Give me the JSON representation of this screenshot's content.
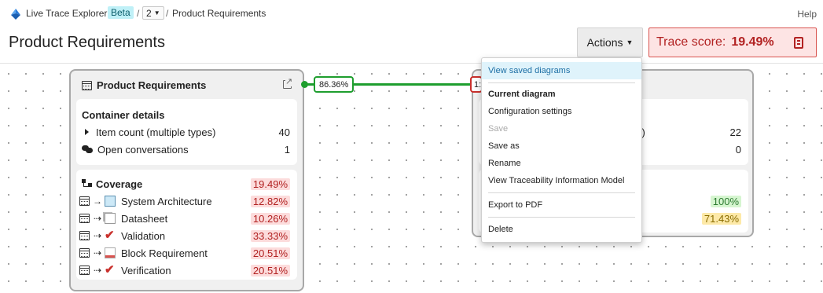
{
  "header": {
    "app_title": "Live Trace Explorer",
    "beta_badge": "Beta",
    "separator": "/",
    "version_value": "2",
    "breadcrumb_current": "Product Requirements",
    "help_label": "Help"
  },
  "page": {
    "title": "Product Requirements",
    "actions_label": "Actions",
    "trace_score_label": "Trace score:",
    "trace_score_value": "19.49%"
  },
  "left_card": {
    "title": "Product Requirements",
    "details_title": "Container details",
    "item_count_label": "Item count (multiple types)",
    "item_count_value": "40",
    "conversations_label": "Open conversations",
    "conversations_value": "1",
    "coverage_title": "Coverage",
    "coverage_total": "19.49%",
    "coverage_rows": [
      {
        "label": "System Architecture",
        "value": "12.82%"
      },
      {
        "label": "Datasheet",
        "value": "10.26%"
      },
      {
        "label": "Validation",
        "value": "33.33%"
      },
      {
        "label": "Block Requirement",
        "value": "20.51%"
      },
      {
        "label": "Verification",
        "value": "20.51%"
      }
    ]
  },
  "link": {
    "left_pct": "86.36%",
    "right_pct_partial": "1:"
  },
  "right_card": {
    "row1_label_partial": "ypes)",
    "row1_value": "22",
    "row2_value": "0",
    "cov1": "100%",
    "cov2": "71.43%"
  },
  "actions_menu": {
    "items": [
      "View saved diagrams",
      "Current diagram",
      "Configuration settings",
      "Save",
      "Save as",
      "Rename",
      "View Traceability Information Model",
      "Export to PDF",
      "Delete"
    ]
  },
  "colors": {
    "link_green": "#1e9e2e",
    "score_red": "#b22222",
    "highlight": "#dff3fb"
  }
}
